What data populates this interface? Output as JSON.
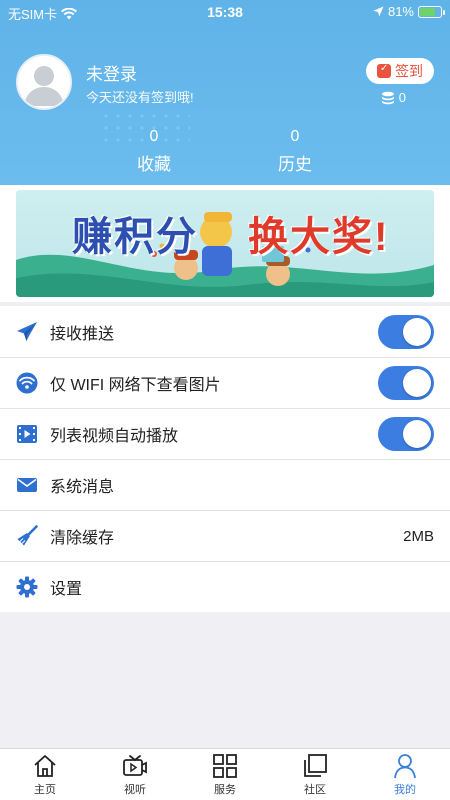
{
  "status_bar": {
    "carrier": "无SIM卡",
    "time": "15:38",
    "battery": "81%",
    "battery_level": 0.81
  },
  "profile": {
    "name": "未登录",
    "subtitle": "今天还没有签到哦!",
    "signin_label": "签到",
    "coins": "0"
  },
  "stats": [
    {
      "value": "0",
      "label": "收藏"
    },
    {
      "value": "0",
      "label": "历史"
    }
  ],
  "banner": {
    "text_left": "赚积分",
    "text_right": "换大奖!"
  },
  "settings": [
    {
      "label": "接收推送",
      "icon": "paper-plane-icon",
      "toggle": true
    },
    {
      "label": "仅 WIFI 网络下查看图片",
      "icon": "wifi-icon",
      "toggle": true
    },
    {
      "label": "列表视频自动播放",
      "icon": "video-icon",
      "toggle": true
    },
    {
      "label": "系统消息",
      "icon": "mail-icon"
    },
    {
      "label": "清除缓存",
      "icon": "broom-icon",
      "value": "2MB"
    },
    {
      "label": "设置",
      "icon": "gear-icon"
    }
  ],
  "tabs": [
    {
      "label": "主页",
      "icon": "home-icon"
    },
    {
      "label": "视听",
      "icon": "tv-icon"
    },
    {
      "label": "服务",
      "icon": "grid-icon"
    },
    {
      "label": "社区",
      "icon": "layers-icon"
    },
    {
      "label": "我的",
      "icon": "person-icon",
      "active": true
    }
  ],
  "colors": {
    "header": "#5fb3e8",
    "accent": "#3b7de0",
    "signin": "#e8543d",
    "active_tab": "#3a7fdc"
  }
}
